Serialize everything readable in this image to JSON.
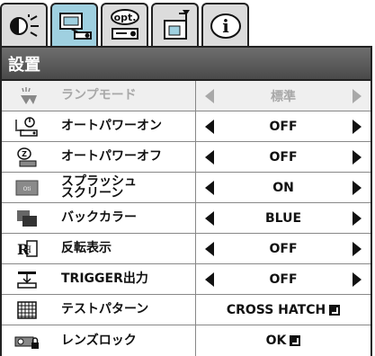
{
  "tabs": [
    {
      "icon": "picture-adjust-icon"
    },
    {
      "icon": "setup-icon",
      "active": true
    },
    {
      "icon": "options-icon",
      "label": "opt."
    },
    {
      "icon": "input-icon"
    },
    {
      "icon": "info-icon",
      "label": "i"
    }
  ],
  "header": {
    "title": "設置"
  },
  "rows": [
    {
      "label": "ランプモード",
      "value": "標準",
      "icon": "lamp-mode-icon",
      "disabled": true
    },
    {
      "label": "オートパワーオン",
      "value": "OFF",
      "icon": "auto-power-on-icon"
    },
    {
      "label": "オートパワーオフ",
      "value": "OFF",
      "icon": "auto-power-off-icon"
    },
    {
      "label": "スプラッシュ\nスクリーン",
      "value": "ON",
      "icon": "splash-screen-icon"
    },
    {
      "label": "バックカラー",
      "value": "BLUE",
      "icon": "background-color-icon"
    },
    {
      "label": "反転表示",
      "value": "OFF",
      "icon": "image-flip-icon"
    },
    {
      "label": "TRIGGER出力",
      "value": "OFF",
      "icon": "trigger-output-icon"
    },
    {
      "label": "テストパターン",
      "value": "CROSS HATCH",
      "icon": "test-pattern-icon"
    },
    {
      "label": "レンズロック",
      "value": "OK",
      "icon": "lens-lock-icon"
    }
  ],
  "colors": {
    "active_tab": "#9fd0e0",
    "inactive_tab": "#dcdcdc",
    "header": "#555555",
    "disabled_text": "#a8a8a8"
  }
}
